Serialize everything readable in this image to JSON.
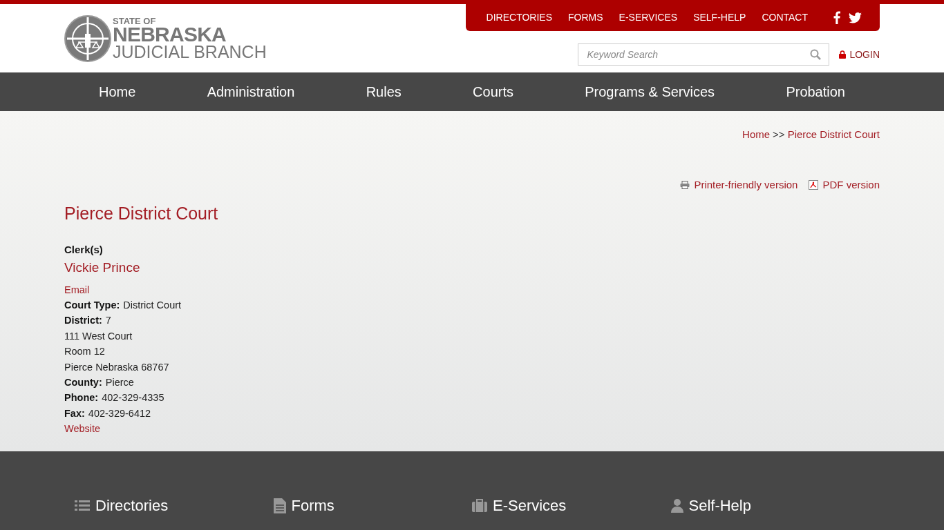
{
  "logo": {
    "line_1": "STATE OF",
    "line_2": "NEBRASKA",
    "line_3": "JUDICIAL BRANCH"
  },
  "utility_nav": [
    "DIRECTORIES",
    "FORMS",
    "E-SERVICES",
    "SELF-HELP",
    "CONTACT"
  ],
  "search": {
    "placeholder": "Keyword Search"
  },
  "login": "LOGIN",
  "main_nav": [
    "Home",
    "Administration",
    "Rules",
    "Courts",
    "Programs & Services",
    "Probation"
  ],
  "breadcrumb": {
    "items": [
      "Home",
      "Pierce District Court"
    ],
    "separator": ">>"
  },
  "print_links": {
    "printer": "Printer-friendly version",
    "pdf": "PDF version"
  },
  "page_title": "Pierce District Court",
  "clerk_heading": "Clerk(s)",
  "clerk_name": "Vickie Prince",
  "details": [
    {
      "kind": "link",
      "text": "Email"
    },
    {
      "kind": "field",
      "label": "Court Type:",
      "value": "District Court"
    },
    {
      "kind": "field",
      "label": "District:",
      "value": "7"
    },
    {
      "kind": "text",
      "text": "111 West Court"
    },
    {
      "kind": "text",
      "text": "Room 12"
    },
    {
      "kind": "text",
      "text": "Pierce Nebraska 68767"
    },
    {
      "kind": "field",
      "label": "County:",
      "value": "Pierce"
    },
    {
      "kind": "field",
      "label": "Phone:",
      "value": "402-329-4335"
    },
    {
      "kind": "field",
      "label": "Fax:",
      "value": "402-329-6412"
    },
    {
      "kind": "link",
      "text": "Website"
    }
  ],
  "footer_columns": [
    {
      "kind": "list",
      "title": "Directories"
    },
    {
      "kind": "document",
      "title": "Forms"
    },
    {
      "kind": "briefcase",
      "title": "E-Services"
    },
    {
      "kind": "person",
      "title": "Self-Help"
    }
  ]
}
